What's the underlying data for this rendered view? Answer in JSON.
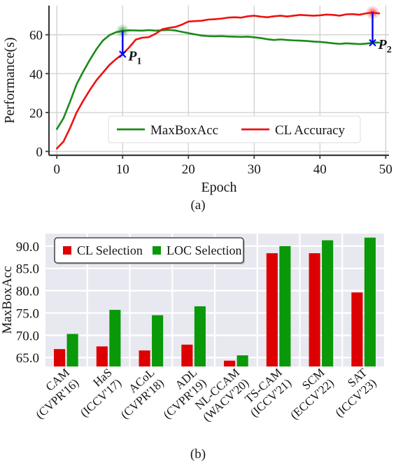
{
  "figure": {
    "caption_a": "(a)",
    "caption_b": "(b)"
  },
  "chart_data": [
    {
      "id": "line-chart",
      "type": "line",
      "title": "",
      "xlabel": "Epoch",
      "ylabel": "Performance(s)",
      "xlim": [
        -1.2,
        50.5
      ],
      "ylim": [
        -2.0,
        75.0
      ],
      "xticks": [
        0,
        10,
        20,
        30,
        40,
        50
      ],
      "xticklabels": [
        "0",
        "10",
        "20",
        "30",
        "40",
        "50"
      ],
      "yticks": [
        0,
        20,
        40,
        60
      ],
      "yticklabels": [
        "0",
        "20",
        "40",
        "60"
      ],
      "grid": true,
      "legend_position": "lower center",
      "series": [
        {
          "name": "MaxBoxAcc",
          "color": "#1a8a1a",
          "x": [
            0,
            1,
            2,
            3,
            4,
            5,
            6,
            7,
            8,
            9,
            10,
            11,
            12,
            13,
            14,
            15,
            16,
            17,
            18,
            19,
            20,
            21,
            22,
            23,
            24,
            25,
            26,
            27,
            28,
            29,
            30,
            31,
            32,
            33,
            34,
            35,
            36,
            37,
            38,
            39,
            40,
            41,
            42,
            43,
            44,
            45,
            46,
            47,
            48,
            49
          ],
          "y": [
            11.5,
            17.0,
            25.5,
            34.5,
            41.0,
            47.0,
            52.5,
            57.0,
            59.8,
            61.3,
            62.0,
            62.3,
            62.2,
            62.1,
            62.4,
            62.1,
            62.3,
            62.5,
            62.2,
            61.5,
            60.8,
            60.2,
            59.6,
            59.3,
            59.2,
            59.3,
            59.1,
            59.0,
            58.9,
            59.0,
            58.7,
            58.3,
            57.7,
            57.3,
            57.6,
            57.3,
            57.1,
            57.0,
            56.8,
            56.5,
            56.3,
            56.0,
            55.6,
            55.3,
            55.6,
            55.4,
            55.2,
            55.4,
            55.9,
            56.0
          ]
        },
        {
          "name": "CL Accuracy",
          "color": "#ee1111",
          "x": [
            0,
            1,
            2,
            3,
            4,
            5,
            6,
            7,
            8,
            9,
            10,
            11,
            12,
            13,
            14,
            15,
            16,
            17,
            18,
            19,
            20,
            21,
            22,
            23,
            24,
            25,
            26,
            27,
            28,
            29,
            30,
            31,
            32,
            33,
            34,
            35,
            36,
            37,
            38,
            39,
            40,
            41,
            42,
            43,
            44,
            45,
            46,
            47,
            48,
            49
          ],
          "y": [
            1.5,
            5.0,
            12.0,
            20.0,
            26.0,
            31.5,
            36.5,
            40.5,
            44.5,
            47.5,
            50.0,
            53.5,
            57.5,
            58.5,
            58.8,
            60.5,
            62.8,
            63.5,
            64.0,
            65.2,
            66.8,
            67.0,
            67.2,
            67.8,
            68.0,
            68.3,
            68.8,
            69.0,
            68.8,
            69.5,
            69.8,
            69.3,
            69.0,
            69.5,
            69.8,
            69.4,
            69.8,
            70.2,
            70.0,
            69.8,
            70.0,
            70.4,
            70.2,
            69.8,
            70.5,
            70.6,
            70.3,
            71.0,
            71.4,
            71.0
          ]
        }
      ],
      "annotations": [
        {
          "label": "P_1",
          "label_text": "P",
          "subscript": "1",
          "color": "#0000ee",
          "x": 10,
          "y_from": 62.0,
          "y_to": 50.0,
          "marker_color": "#1a8a1a",
          "marker_at": "top"
        },
        {
          "label": "P_2",
          "label_text": "P",
          "subscript": "2",
          "color": "#0000ee",
          "x": 48,
          "y_from": 71.4,
          "y_to": 55.9,
          "marker_color": "#ee1111",
          "marker_at": "top"
        }
      ]
    },
    {
      "id": "bar-chart",
      "type": "bar",
      "title": "",
      "xlabel": "",
      "ylabel": "MaxBoxAcc",
      "ylim": [
        63.0,
        92.8
      ],
      "yticks": [
        65.0,
        70.0,
        75.0,
        80.0,
        85.0,
        90.0
      ],
      "yticklabels": [
        "65.0",
        "70.0",
        "75.0",
        "80.0",
        "85.0",
        "90.0"
      ],
      "grid": true,
      "plot_bgcolor": "#e8e8f0",
      "gridcolor": "#ffffff",
      "legend_position": "upper left",
      "categories": [
        "CAM\n(CVPR'16)",
        "HaS\n(ICCV'17)",
        "ACoL\n(CVPR'18)",
        "ADL\n(CVPR'19)",
        "NL-CCAM\n(WACV'20)",
        "TS-CAM\n(ICCV'21)",
        "SCM\n(ECCV'22)",
        "SAT\n(ICCV'23)"
      ],
      "category_lines": [
        [
          "CAM",
          "(CVPR'16)"
        ],
        [
          "HaS",
          "(ICCV'17)"
        ],
        [
          "ACoL",
          "(CVPR'18)"
        ],
        [
          "ADL",
          "(CVPR'19)"
        ],
        [
          "NL-CCAM",
          "(WACV'20)"
        ],
        [
          "TS-CAM",
          "(ICCV'21)"
        ],
        [
          "SCM",
          "(ECCV'22)"
        ],
        [
          "SAT",
          "(ICCV'23)"
        ]
      ],
      "series": [
        {
          "name": "CL Selection",
          "color": "#dd0000",
          "values": [
            66.9,
            67.5,
            66.6,
            67.9,
            64.3,
            88.4,
            88.4,
            79.6
          ]
        },
        {
          "name": "LOC Selection",
          "color": "#099909",
          "values": [
            70.3,
            75.7,
            74.5,
            76.5,
            65.5,
            90.0,
            91.3,
            91.9
          ]
        }
      ]
    }
  ],
  "colors": {
    "red": "#dd0000",
    "green": "#099909",
    "line_green": "#1a8a1a",
    "line_red": "#ee1111",
    "annotation_blue": "#0000ee",
    "bar_panel_bg": "#e8e8f0",
    "grid": "#ffffff"
  }
}
